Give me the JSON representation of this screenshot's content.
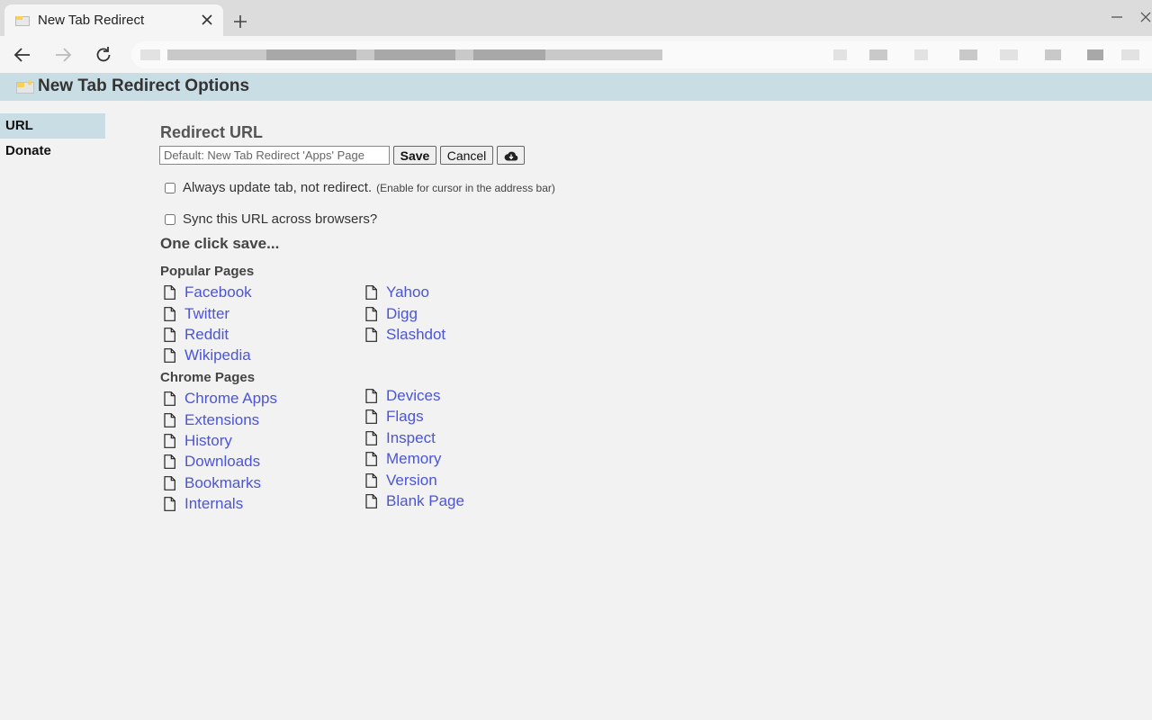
{
  "browser": {
    "tab_title": "New Tab Redirect",
    "new_tab_symbol": "+"
  },
  "page": {
    "title": "New Tab Redirect Options"
  },
  "sidebar": {
    "items": [
      {
        "label": "URL",
        "active": true
      },
      {
        "label": "Donate",
        "active": false
      }
    ]
  },
  "redirect": {
    "section_title": "Redirect URL",
    "input_placeholder": "Default: New Tab Redirect 'Apps' Page",
    "input_value": "",
    "save_label": "Save",
    "cancel_label": "Cancel",
    "cloud_icon": "cloud-download-icon"
  },
  "options": {
    "always_update_label": "Always update tab, not redirect.",
    "always_update_note": "(Enable for cursor in the address bar)",
    "always_update_checked": false,
    "sync_label": "Sync this URL across browsers?",
    "sync_checked": false
  },
  "one_click": {
    "title": "One click save...",
    "popular": {
      "title": "Popular Pages",
      "col1": [
        "Facebook",
        "Twitter",
        "Reddit",
        "Wikipedia"
      ],
      "col2": [
        "Yahoo",
        "Digg",
        "Slashdot"
      ]
    },
    "chrome": {
      "title": "Chrome Pages",
      "col1": [
        "Chrome Apps",
        "Extensions",
        "History",
        "Downloads",
        "Bookmarks",
        "Internals"
      ],
      "col2": [
        "Devices",
        "Flags",
        "Inspect",
        "Memory",
        "Version",
        "Blank Page"
      ]
    }
  },
  "colors": {
    "header_bg": "#c9dde4",
    "link": "#4b55d6",
    "page_bg": "#f2f2f2"
  }
}
